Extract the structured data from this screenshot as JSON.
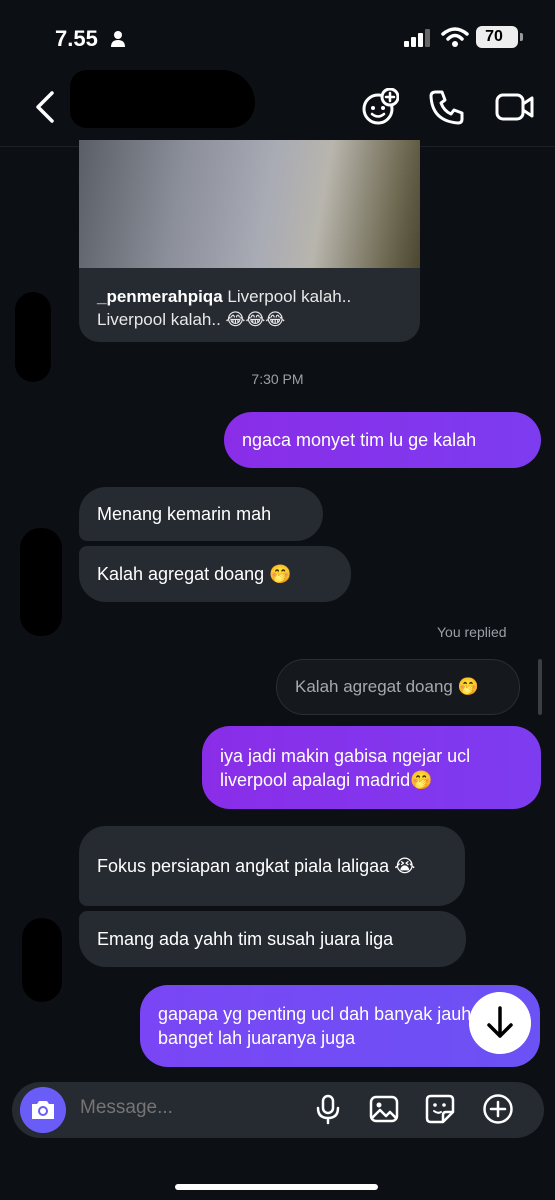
{
  "status_bar": {
    "time": "7.55",
    "battery": "70"
  },
  "header": {
    "icons": [
      "back-chevron-icon",
      "video-game-effects-icon",
      "phone-icon",
      "video-camera-icon"
    ]
  },
  "shared_post": {
    "username": "_penmerahpiqa",
    "caption": "Liverpool kalah.. Liverpool kalah.. 😂😂😂"
  },
  "timestamp": "7:30 PM",
  "messages": [
    {
      "side": "out",
      "text": "ngaca monyet tim lu ge kalah"
    },
    {
      "side": "in",
      "text": "Menang kemarin mah"
    },
    {
      "side": "in",
      "text": "Kalah agregat doang 🤭"
    },
    {
      "side": "out",
      "text": "iya jadi makin gabisa ngejar ucl liverpool apalagi madrid🤭"
    },
    {
      "side": "in",
      "text": "Fokus persiapan angkat piala laligaa 😭"
    },
    {
      "side": "in",
      "text": "Emang ada yahh tim susah juara liga"
    },
    {
      "side": "out",
      "text": "gapapa yg penting ucl dah banyak jauh banget lah juaranya juga"
    }
  ],
  "reply": {
    "label": "You replied",
    "quote": "Kalah agregat doang 🤭"
  },
  "composer": {
    "placeholder": "Message..."
  },
  "colors": {
    "outgoing": "#8a2de8",
    "incoming": "#262a31",
    "background": "#0c0f14"
  }
}
